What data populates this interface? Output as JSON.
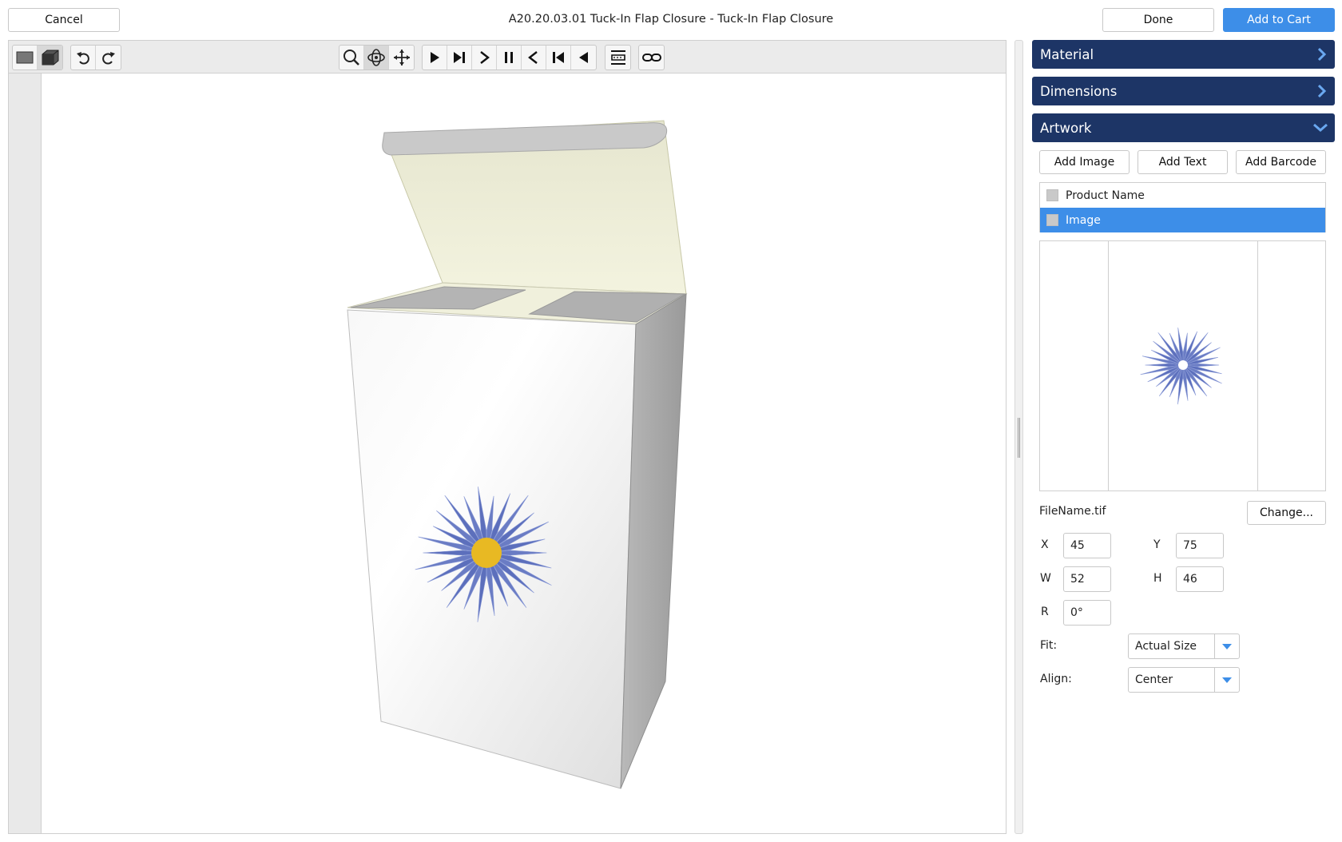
{
  "header": {
    "title": "A20.20.03.01 Tuck-In Flap Closure - Tuck-In Flap Closure",
    "cancel_label": "Cancel",
    "done_label": "Done",
    "add_to_cart_label": "Add to Cart"
  },
  "toolbar": {
    "groups": [
      [
        "flat-view-icon",
        "3d-view-icon"
      ],
      [
        "undo-icon",
        "redo-icon"
      ],
      [
        "zoom-icon",
        "orbit-icon",
        "pan-icon"
      ],
      [
        "play-icon",
        "skip-to-end-icon",
        "step-forward-icon",
        "pause-icon",
        "step-back-icon",
        "skip-to-start-icon",
        "play-reverse-icon"
      ],
      [
        "fold-settings-icon"
      ],
      [
        "link-icon"
      ]
    ],
    "active": [
      "3d-view-icon",
      "orbit-icon"
    ]
  },
  "panel": {
    "sections": [
      {
        "label": "Material",
        "expanded": false
      },
      {
        "label": "Dimensions",
        "expanded": false
      },
      {
        "label": "Artwork",
        "expanded": true
      }
    ],
    "artwork": {
      "add_image_label": "Add Image",
      "add_text_label": "Add Text",
      "add_barcode_label": "Add Barcode",
      "layers": [
        {
          "label": "Product Name",
          "selected": false
        },
        {
          "label": "Image",
          "selected": true
        }
      ],
      "file_name": "FileName.tif",
      "change_label": "Change...",
      "x_label": "X",
      "x_value": "45",
      "y_label": "Y",
      "y_value": "75",
      "w_label": "W",
      "w_value": "52",
      "h_label": "H",
      "h_value": "46",
      "r_label": "R",
      "r_value": "0°",
      "fit_label": "Fit:",
      "fit_value": "Actual Size",
      "align_label": "Align:",
      "align_value": "Center"
    }
  },
  "colors": {
    "accent": "#3d8ee8",
    "header_navy": "#1d3566",
    "flower_petal": "#6a7cc4",
    "flower_center": "#e8b923"
  }
}
